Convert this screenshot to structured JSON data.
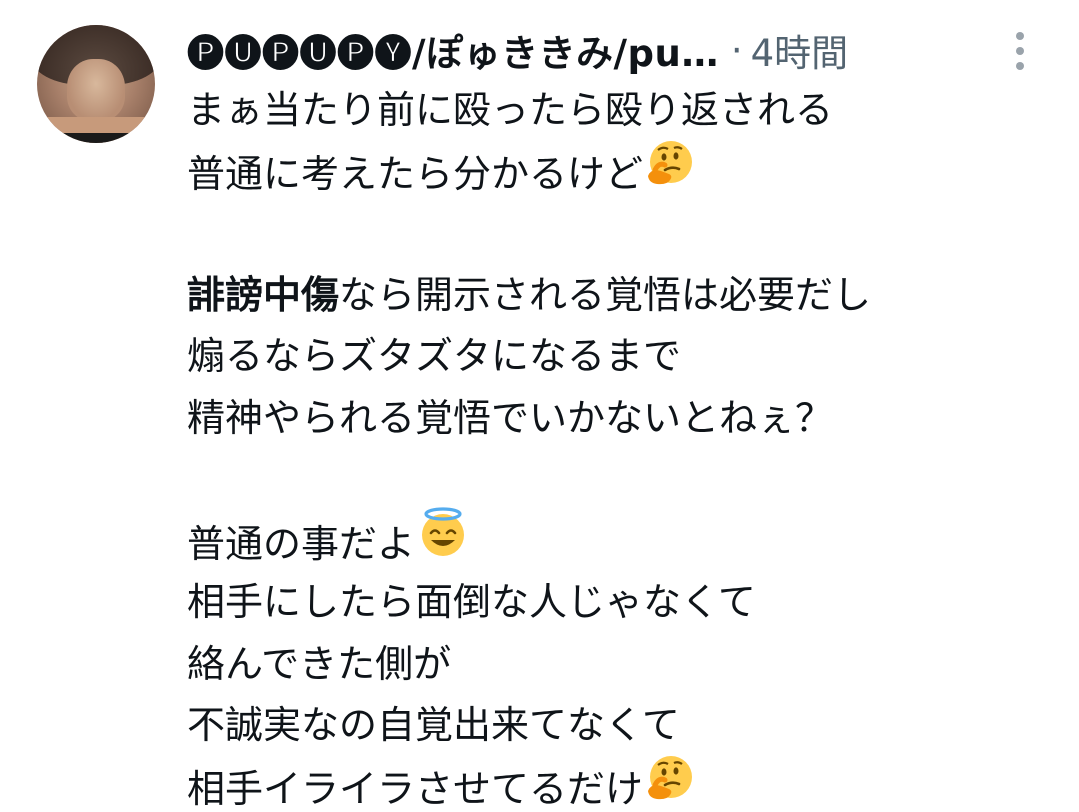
{
  "tweet": {
    "display_name": "🅟🅤🅟🅤🅟🅨/ぽゅききみ/pu…",
    "separator": "·",
    "timestamp": "4時間",
    "more_icon": "more-vertical-icon",
    "lines": [
      "まぁ当たり前に殴ったら殴り返される",
      "普通に考えたら分かるけど",
      "",
      "誹謗中傷",
      "なら開示される覚悟は必要だし",
      "煽るならズタズタになるまで",
      "精神やられる覚悟でいかないとねぇ？",
      "",
      "普通の事だよ",
      "相手にしたら面倒な人じゃなくて",
      "絡んできた側が",
      "不誠実なの自覚出来てなくて",
      "相手イライラさせてるだけ"
    ],
    "emoji": {
      "thinking": "thinking-face-emoji",
      "halo": "smiling-face-with-halo-emoji"
    }
  }
}
